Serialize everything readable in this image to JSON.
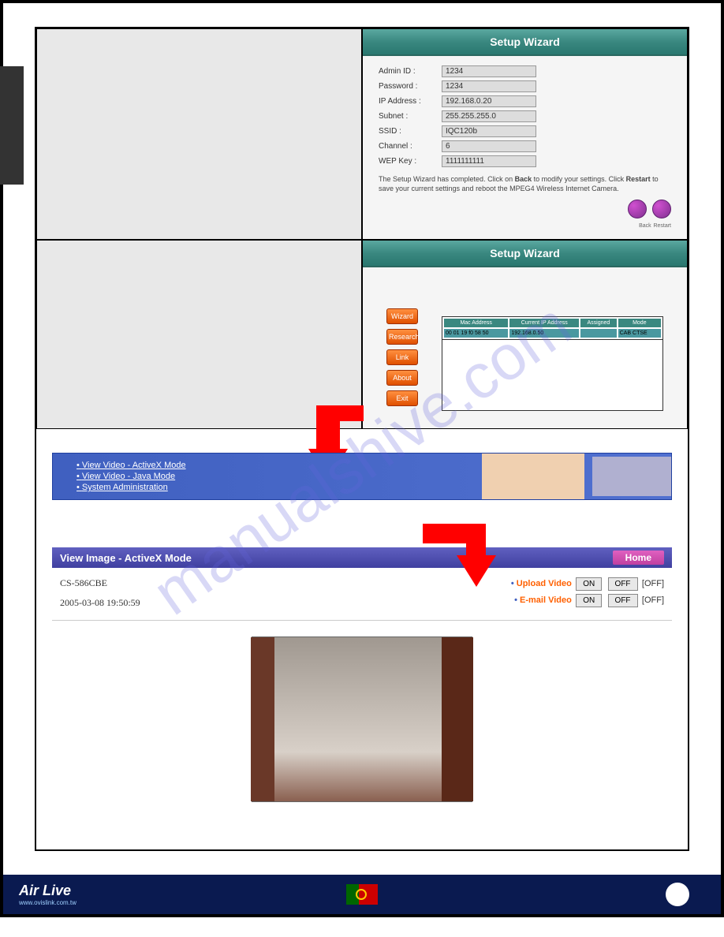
{
  "watermark": "manualshive.com",
  "wizard": {
    "title": "Setup Wizard",
    "fields": [
      {
        "label": "Admin ID :",
        "value": "1234"
      },
      {
        "label": "Password :",
        "value": "1234"
      },
      {
        "label": "IP Address :",
        "value": "192.168.0.20"
      },
      {
        "label": "Subnet :",
        "value": "255.255.255.0"
      },
      {
        "label": "SSID :",
        "value": "IQC120b"
      },
      {
        "label": "Channel :",
        "value": "6"
      },
      {
        "label": "WEP Key :",
        "value": "1111111111"
      }
    ],
    "note_pre": "The Setup Wizard has completed. Click on ",
    "note_back": "Back",
    "note_mid": " to modify your settings. Click ",
    "note_restart": "Restart",
    "note_post": " to save your current settings and reboot the MPEG4 Wireless Internet Camera.",
    "btn_back": "Back",
    "btn_restart": "Restart"
  },
  "wizard2": {
    "title": "Setup Wizard",
    "buttons": [
      "Wizard",
      "Research",
      "Link",
      "About",
      "Exit"
    ],
    "table_headers": [
      "Mac Address",
      "Current IP Address",
      "Assigned",
      "Mode"
    ],
    "table_row": [
      "00 01 19 f0 58 50",
      "192.168.0.50",
      "",
      "CAB CTSE"
    ]
  },
  "banner": {
    "links": [
      "View Video - ActiveX Mode",
      "View Video - Java Mode",
      "System Administration"
    ]
  },
  "viewer": {
    "title": "View Image - ActiveX Mode",
    "home": "Home",
    "camera": "CS-586CBE",
    "timestamp": "2005-03-08 19:50:59",
    "upload_label": "Upload Video",
    "email_label": "E-mail Video",
    "on": "ON",
    "off": "OFF",
    "status_off": "[OFF]"
  },
  "footer": {
    "brand": "Air Live",
    "url": "www.ovislink.com.tw"
  }
}
